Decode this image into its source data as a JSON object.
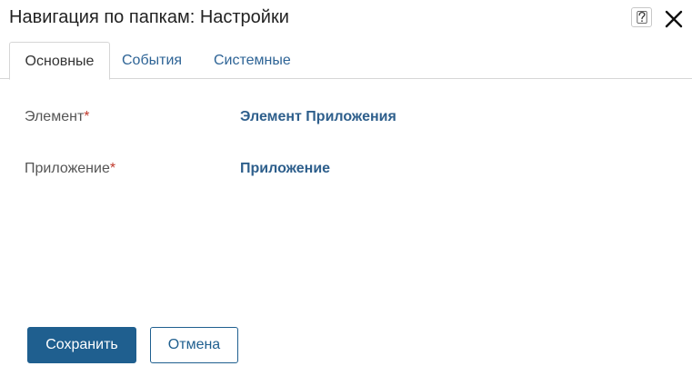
{
  "dialog": {
    "title": "Навигация по папкам: Настройки",
    "help_icon": "question-icon",
    "close_icon": "close-icon"
  },
  "tabs": [
    {
      "label": "Основные",
      "active": true
    },
    {
      "label": "События",
      "active": false
    },
    {
      "label": "Системные",
      "active": false
    }
  ],
  "fields": [
    {
      "label": "Элемент",
      "required_mark": "*",
      "value": "Элемент Приложения"
    },
    {
      "label": "Приложение",
      "required_mark": "*",
      "value": "Приложение"
    }
  ],
  "buttons": {
    "save_label": "Сохранить",
    "cancel_label": "Отмена"
  },
  "colors": {
    "primary": "#1f5f8f",
    "link": "#2e5f8c",
    "required": "#c0392b"
  }
}
